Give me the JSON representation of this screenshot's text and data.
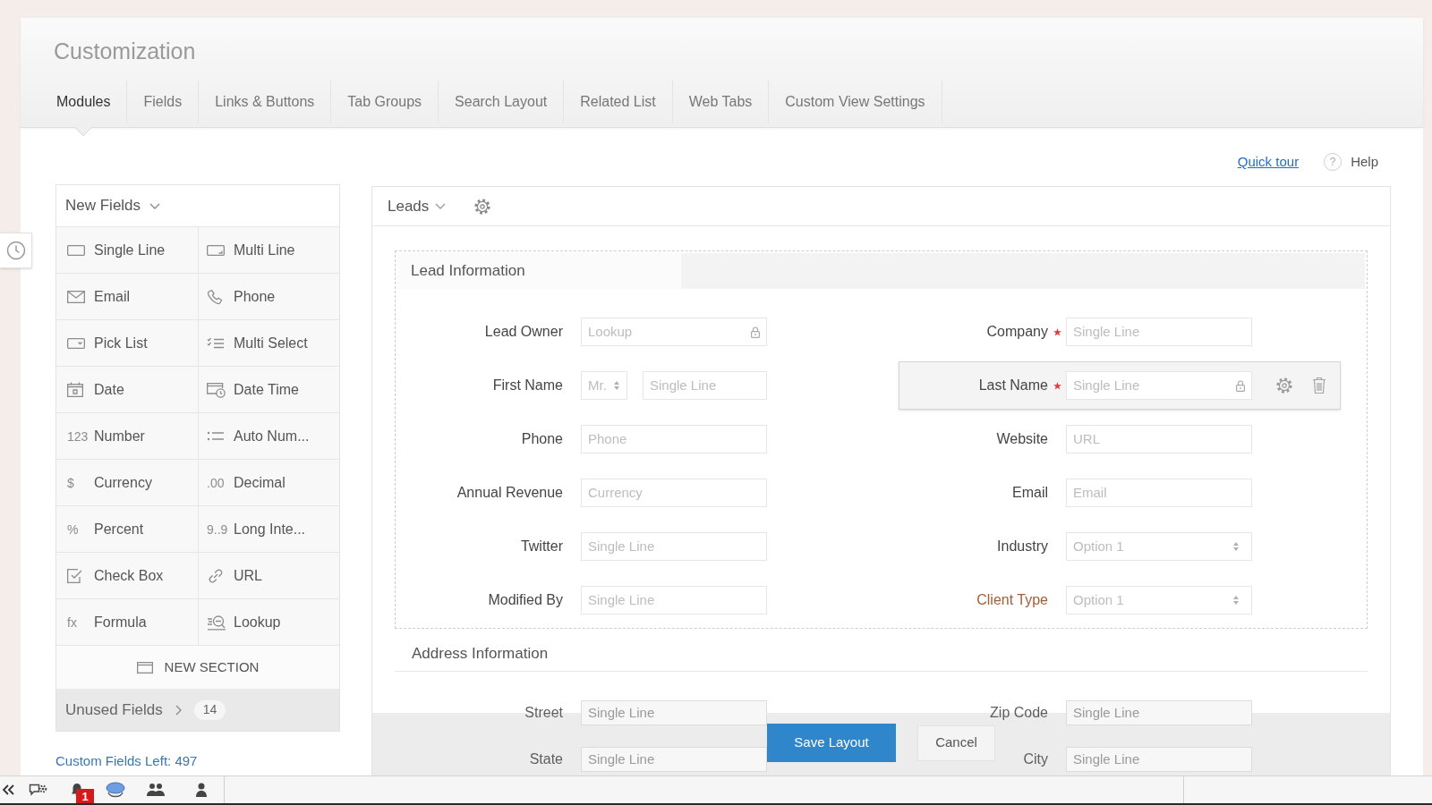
{
  "header": {
    "title": "Customization",
    "tabs": [
      {
        "label": "Modules",
        "selected": true
      },
      {
        "label": "Fields",
        "selected": false
      },
      {
        "label": "Links & Buttons",
        "selected": false
      },
      {
        "label": "Tab Groups",
        "selected": false
      },
      {
        "label": "Search Layout",
        "selected": false
      },
      {
        "label": "Related List",
        "selected": false
      },
      {
        "label": "Web Tabs",
        "selected": false
      },
      {
        "label": "Custom View Settings",
        "selected": false
      }
    ]
  },
  "help_bar": {
    "quick_tour": "Quick tour",
    "help_icon": "?",
    "help": "Help"
  },
  "new_fields": {
    "title": "New Fields",
    "items": [
      {
        "label": "Single Line",
        "kind": "single_line"
      },
      {
        "label": "Multi Line",
        "kind": "multi_line"
      },
      {
        "label": "Email",
        "kind": "email"
      },
      {
        "label": "Phone",
        "kind": "phone"
      },
      {
        "label": "Pick List",
        "kind": "pick_list"
      },
      {
        "label": "Multi Select",
        "kind": "multi_select"
      },
      {
        "label": "Date",
        "kind": "date"
      },
      {
        "label": "Date Time",
        "kind": "date_time"
      },
      {
        "label": "Number",
        "kind": "number",
        "glyph": "123"
      },
      {
        "label": "Auto Num...",
        "kind": "auto_number"
      },
      {
        "label": "Currency",
        "kind": "currency",
        "glyph": "$"
      },
      {
        "label": "Decimal",
        "kind": "decimal",
        "glyph": ".00"
      },
      {
        "label": "Percent",
        "kind": "percent",
        "glyph": "%"
      },
      {
        "label": "Long Inte...",
        "kind": "long_integer",
        "glyph": "9..9"
      },
      {
        "label": "Check Box",
        "kind": "check_box"
      },
      {
        "label": "URL",
        "kind": "url"
      },
      {
        "label": "Formula",
        "kind": "formula",
        "glyph": "fx"
      },
      {
        "label": "Lookup",
        "kind": "lookup"
      }
    ],
    "new_section": "NEW SECTION",
    "unused_fields": {
      "label": "Unused Fields",
      "count": "14"
    },
    "custom_fields_left": "Custom Fields Left: 497"
  },
  "layout": {
    "module": "Leads",
    "sections": [
      {
        "title": "Lead Information",
        "kind": "boxed",
        "left_fields": [
          {
            "label": "Lead Owner",
            "kind": "lookup",
            "placeholder": "Lookup",
            "required": false,
            "locked": true,
            "hovered": false,
            "custom": false
          },
          {
            "label": "First Name",
            "kind": "salutation",
            "salutation": "Mr.",
            "placeholder": "Single Line",
            "required": false,
            "locked": false,
            "hovered": false,
            "custom": false
          },
          {
            "label": "Phone",
            "kind": "text",
            "placeholder": "Phone",
            "required": false,
            "locked": false,
            "hovered": false,
            "custom": false
          },
          {
            "label": "Annual Revenue",
            "kind": "text",
            "placeholder": "Currency",
            "required": false,
            "locked": false,
            "hovered": false,
            "custom": false
          },
          {
            "label": "Twitter",
            "kind": "text",
            "placeholder": "Single Line",
            "required": false,
            "locked": false,
            "hovered": false,
            "custom": false
          },
          {
            "label": "Modified By",
            "kind": "text",
            "placeholder": "Single Line",
            "required": false,
            "locked": false,
            "hovered": false,
            "custom": false
          }
        ],
        "right_fields": [
          {
            "label": "Company",
            "kind": "text",
            "placeholder": "Single Line",
            "required": true,
            "locked": false,
            "hovered": false,
            "custom": false
          },
          {
            "label": "Last Name",
            "kind": "text",
            "placeholder": "Single Line",
            "required": true,
            "locked": true,
            "hovered": true,
            "custom": false
          },
          {
            "label": "Website",
            "kind": "text",
            "placeholder": "URL",
            "required": false,
            "locked": false,
            "hovered": false,
            "custom": false
          },
          {
            "label": "Email",
            "kind": "text",
            "placeholder": "Email",
            "required": false,
            "locked": false,
            "hovered": false,
            "custom": false
          },
          {
            "label": "Industry",
            "kind": "picklist",
            "placeholder": "Option 1",
            "required": false,
            "locked": false,
            "hovered": false,
            "custom": false
          },
          {
            "label": "Client Type",
            "kind": "picklist",
            "placeholder": "Option 1",
            "required": false,
            "locked": false,
            "hovered": false,
            "custom": true
          }
        ]
      },
      {
        "title": "Address Information",
        "kind": "plain",
        "left_fields": [
          {
            "label": "Street",
            "kind": "text",
            "placeholder": "Single Line",
            "required": false,
            "locked": false,
            "hovered": false,
            "custom": false
          },
          {
            "label": "State",
            "kind": "text",
            "placeholder": "Single Line",
            "required": false,
            "locked": false,
            "hovered": false,
            "custom": false
          }
        ],
        "right_fields": [
          {
            "label": "Zip Code",
            "kind": "text",
            "placeholder": "Single Line",
            "required": false,
            "locked": false,
            "hovered": false,
            "custom": false
          },
          {
            "label": "City",
            "kind": "text",
            "placeholder": "Single Line",
            "required": false,
            "locked": false,
            "hovered": false,
            "custom": false
          }
        ]
      }
    ]
  },
  "footer": {
    "buttons": [
      {
        "label": "Save Layout",
        "kind": "primary"
      },
      {
        "label": "Cancel",
        "kind": "secondary"
      }
    ]
  },
  "taskbar": {
    "notification_badge": "1"
  }
}
